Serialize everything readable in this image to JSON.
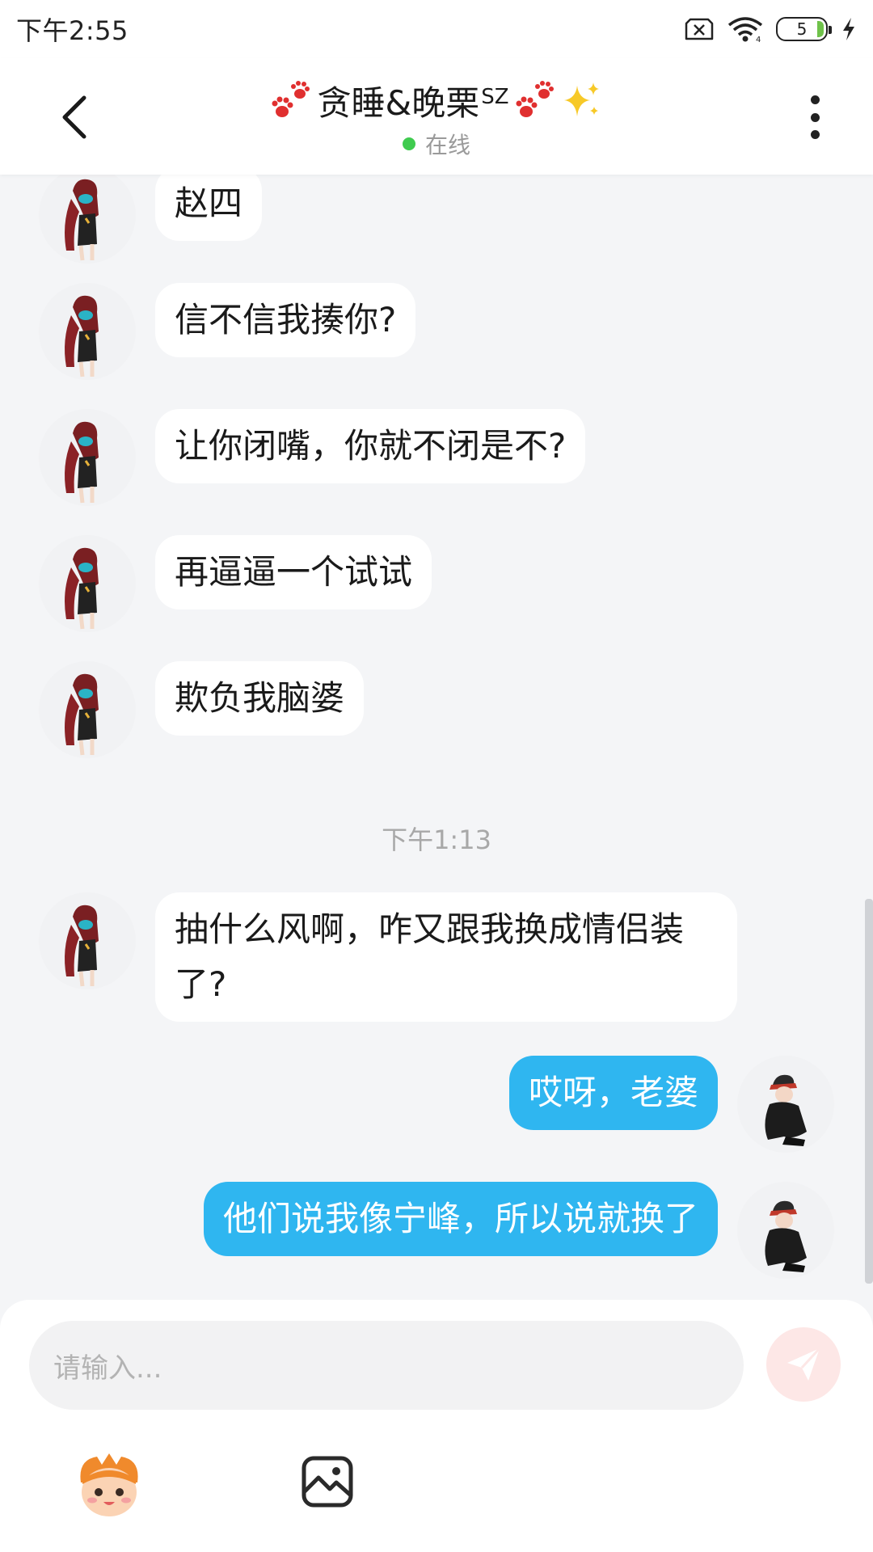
{
  "status_bar": {
    "time": "下午2:55",
    "battery_level": "5",
    "icons": [
      "sim-off-icon",
      "wifi-icon",
      "battery-icon",
      "charging-icon"
    ]
  },
  "header": {
    "title": "贪睡&晚栗",
    "title_sup": "SZ",
    "status": "在线",
    "icons": [
      "back-icon",
      "paw-icon",
      "sparkles-icon",
      "more-vertical-icon"
    ]
  },
  "messages": [
    {
      "side": "left",
      "text": "赵四"
    },
    {
      "side": "left",
      "text": "信不信我揍你?"
    },
    {
      "side": "left",
      "text": "让你闭嘴，你就不闭是不?"
    },
    {
      "side": "left",
      "text": "再逼逼一个试试"
    },
    {
      "side": "left",
      "text": "欺负我脑婆"
    },
    {
      "side": "left",
      "text": "抽什么风啊，咋又跟我换成情侣装了?"
    },
    {
      "side": "right",
      "text": "哎呀，老婆"
    },
    {
      "side": "right",
      "text": "他们说我像宁峰，所以说就换了"
    }
  ],
  "time_divider": "下午1:13",
  "input": {
    "placeholder": "请输入..."
  },
  "toolbar_icons": [
    "emoji-mascot-icon",
    "image-icon",
    "send-icon"
  ],
  "colors": {
    "outgoing_bubble": "#2fb6f0",
    "incoming_bubble": "#ffffff",
    "background": "#f4f5f7",
    "online": "#3fcb4f",
    "send_button_bg": "#fde7e6"
  }
}
